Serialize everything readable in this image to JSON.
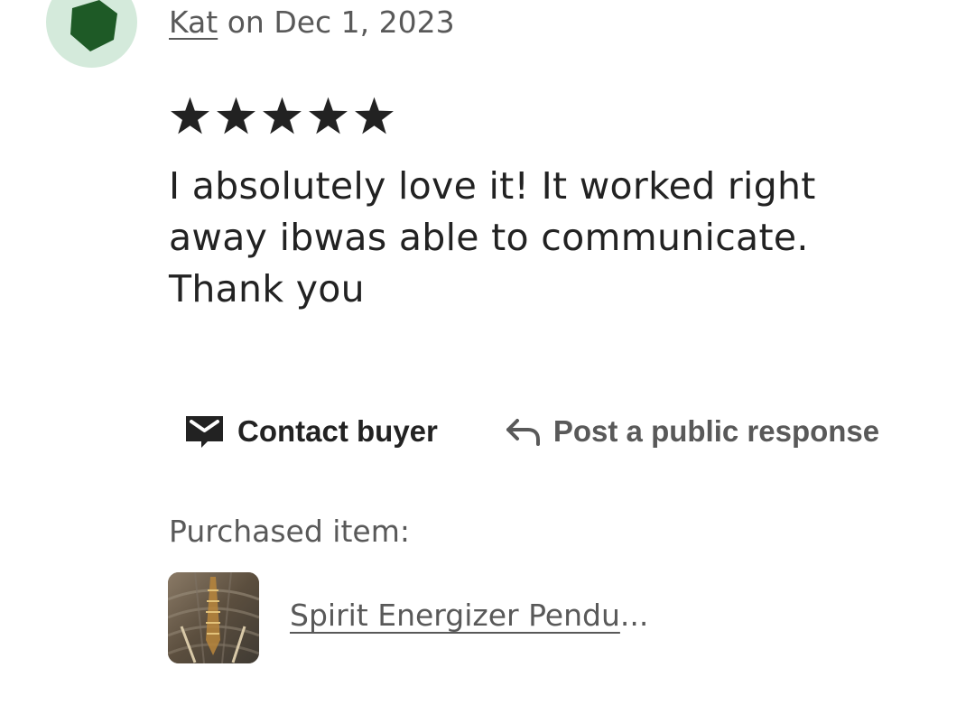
{
  "review": {
    "author": "Kat",
    "date_text": " on Dec 1, 2023",
    "rating": 5,
    "rating_max": 5,
    "text": "I absolutely love it! It worked right away ibwas able to communicate. Thank you"
  },
  "actions": {
    "contact_buyer": "Contact buyer",
    "post_response": "Post a public response"
  },
  "purchased": {
    "label": "Purchased item:",
    "item_name": "Spirit Energizer Pendu",
    "item_ellipsis": "..."
  },
  "icons": {
    "avatar": "pentagon-avatar-icon",
    "star": "star-icon",
    "contact": "message-icon",
    "response": "reply-arrow-icon"
  },
  "colors": {
    "avatar_bg": "#d4eadb",
    "avatar_shape": "#1e5a26",
    "text_primary": "#222222",
    "text_secondary": "#595959"
  }
}
